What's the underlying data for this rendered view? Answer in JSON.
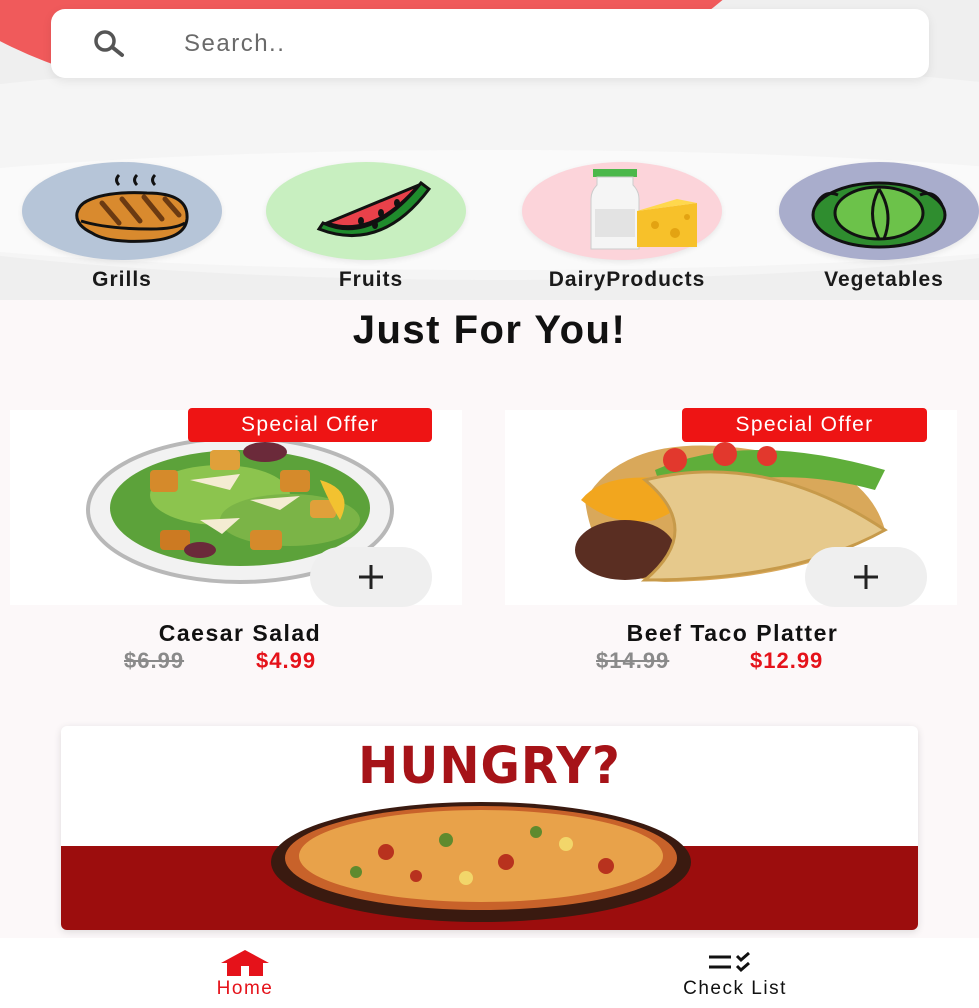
{
  "search": {
    "placeholder": "Search.."
  },
  "categories": [
    {
      "label": "Grills",
      "icon": "steak-icon",
      "bg": "#b6c5d8"
    },
    {
      "label": "Fruits",
      "icon": "watermelon-icon",
      "bg": "#c8efc0"
    },
    {
      "label": "DairyProducts",
      "icon": "milk-cheese-icon",
      "bg": "#fcd4da"
    },
    {
      "label": "Vegetables",
      "icon": "cabbage-icon",
      "bg": "#a9adcc"
    }
  ],
  "section_title": "Just For You!",
  "products": [
    {
      "badge": "Special Offer",
      "name": "Caesar Salad",
      "old_price": "$6.99",
      "price": "$4.99"
    },
    {
      "badge": "Special Offer",
      "name": "Beef Taco Platter",
      "old_price": "$14.99",
      "price": "$12.99"
    }
  ],
  "banner": {
    "title": "HUNGRY?"
  },
  "nav": [
    {
      "label": "Home",
      "active": true
    },
    {
      "label": "Check List",
      "active": false
    }
  ],
  "colors": {
    "accent": "#e5121a",
    "badge": "#ee1414",
    "hero": "#f05a5b"
  }
}
